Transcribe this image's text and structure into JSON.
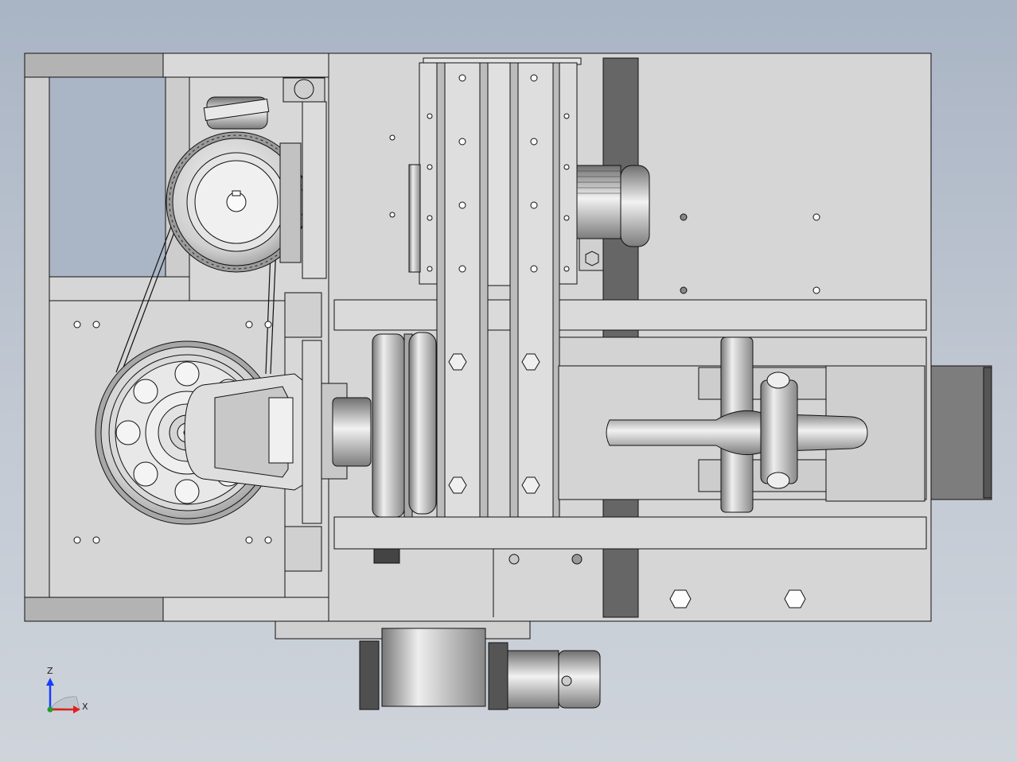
{
  "triad": {
    "z_label": "Z",
    "x_label": "X",
    "z_axis_color": "#1a3cff",
    "x_axis_color": "#e0201b",
    "origin_color": "#1fa02a"
  },
  "viewport": {
    "background_top": "#a9b4c4",
    "background_bottom": "#cfd4db",
    "part_fill": "#d5d5d5",
    "outline": "#111111"
  }
}
